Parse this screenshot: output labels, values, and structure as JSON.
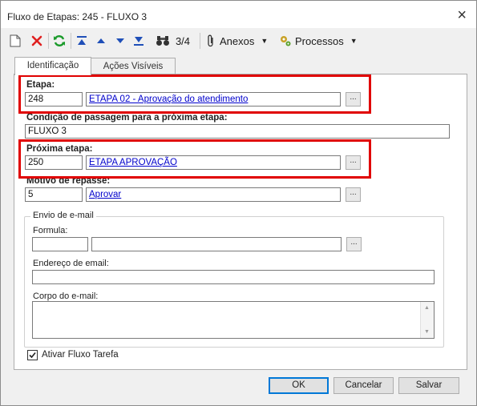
{
  "window": {
    "title": "Fluxo de Etapas: 245 - FLUXO 3",
    "close_glyph": "×"
  },
  "toolbar": {
    "items": [
      {
        "name": "new-document-icon"
      },
      {
        "name": "delete-x-icon",
        "color": "#e02020"
      },
      {
        "name": "refresh-icon",
        "color": "#1a9a2a"
      },
      {
        "name": "move-first-icon",
        "color": "#1f4fb8"
      },
      {
        "name": "move-up-icon",
        "color": "#1f4fb8"
      },
      {
        "name": "move-down-icon",
        "color": "#1f4fb8"
      },
      {
        "name": "move-last-icon",
        "color": "#1f4fb8"
      },
      {
        "name": "binoculars-icon"
      }
    ],
    "record_counter": "3/4",
    "anexos_label": "Anexos",
    "processos_label": "Processos",
    "dropdown_caret": "▼"
  },
  "tabs": [
    {
      "label": "Identificação",
      "active": true
    },
    {
      "label": "Ações Visíveis",
      "active": false
    }
  ],
  "form": {
    "etapa": {
      "label": "Etapa:",
      "code": "248",
      "link": "ETAPA 02 - Aprovação do atendimento"
    },
    "condicao": {
      "label": "Condição de passagem para a próxima etapa:",
      "value": "FLUXO 3"
    },
    "proxima": {
      "label": "Próxima etapa:",
      "code": "250",
      "link": "ETAPA APROVAÇÃO"
    },
    "motivo": {
      "label": "Motivo de repasse:",
      "code": "5",
      "link": "Aprovar"
    },
    "lookup_button": "..."
  },
  "email": {
    "group_title": "Envio de e-mail",
    "formula_label": "Formula:",
    "formula_code": "",
    "formula_value": "",
    "endereco_label": "Endereço de email:",
    "endereco_value": "",
    "corpo_label": "Corpo do e-mail:",
    "corpo_value": ""
  },
  "checkbox": {
    "label": "Ativar Fluxo Tarefa",
    "checked": true
  },
  "buttons": {
    "ok": "OK",
    "cancel": "Cancelar",
    "save": "Salvar"
  },
  "highlight_color": "#e00000"
}
